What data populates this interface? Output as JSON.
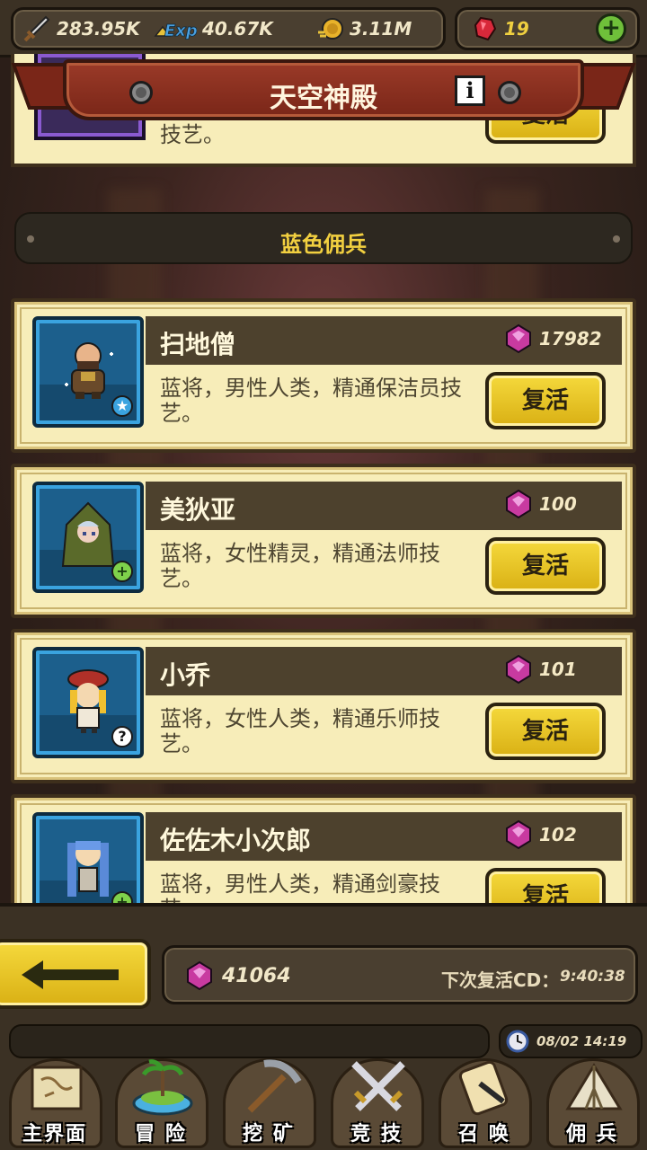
{
  "resources": {
    "attack": "283.95K",
    "exp": "40.67K",
    "gold": "3.11M",
    "gems": "19",
    "add_icon": "plus-icon"
  },
  "banner": {
    "title": "天空神殿",
    "info_label": "i"
  },
  "top_partial_card": {
    "desc_tail": "技艺。",
    "button": "复活"
  },
  "section": {
    "title": "蓝色佣兵"
  },
  "mercenaries": [
    {
      "name": "扫地僧",
      "cost": "17982",
      "desc": "蓝将，男性人类，精通保洁员技艺。",
      "button": "复活",
      "badge": "★"
    },
    {
      "name": "美狄亚",
      "cost": "100",
      "desc": "蓝将，女性精灵，精通法师技艺。",
      "button": "复活",
      "badge": "+"
    },
    {
      "name": "小乔",
      "cost": "101",
      "desc": "蓝将，女性人类，精通乐师技艺。",
      "button": "复活",
      "badge": "?"
    },
    {
      "name": "佐佐木小次郎",
      "cost": "102",
      "desc": "蓝将，男性人类，精通剑豪技艺。",
      "button": "复活",
      "badge": "+"
    }
  ],
  "footer": {
    "gem_total": "41064",
    "cd_label": "下次复活CD：",
    "cd_time": "9:40:38",
    "clock": "08/02 14:19"
  },
  "nav": [
    {
      "label": "主界面",
      "icon": "map-scroll-icon"
    },
    {
      "label": "冒 险",
      "icon": "island-icon"
    },
    {
      "label": "挖 矿",
      "icon": "pickaxe-icon"
    },
    {
      "label": "竞 技",
      "icon": "crossed-swords-icon"
    },
    {
      "label": "召 唤",
      "icon": "summon-scroll-icon"
    },
    {
      "label": "佣 兵",
      "icon": "tent-icon"
    }
  ]
}
